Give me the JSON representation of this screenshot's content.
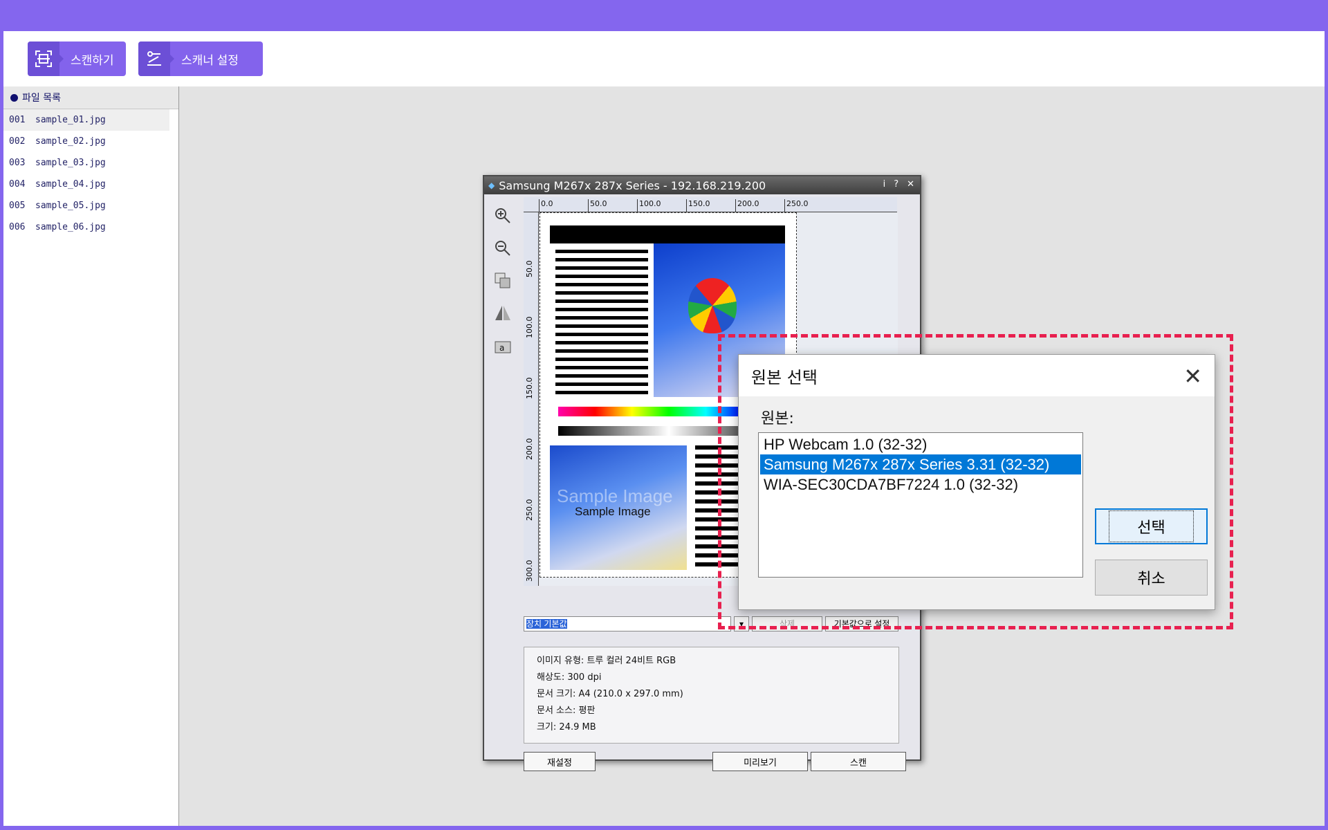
{
  "toolbar": {
    "scan_label": "스캔하기",
    "settings_label": "스캐너 설정"
  },
  "sidebar": {
    "title": "파일 목록",
    "files": [
      {
        "num": "001",
        "name": "sample_01.jpg"
      },
      {
        "num": "002",
        "name": "sample_02.jpg"
      },
      {
        "num": "003",
        "name": "sample_03.jpg"
      },
      {
        "num": "004",
        "name": "sample_04.jpg"
      },
      {
        "num": "005",
        "name": "sample_05.jpg"
      },
      {
        "num": "006",
        "name": "sample_06.jpg"
      }
    ]
  },
  "scanner": {
    "title": "Samsung M267x 287x Series - 192.168.219.200",
    "title_buttons": {
      "info": "i",
      "help": "?",
      "close": "✕"
    },
    "ruler_h": [
      "0.0",
      "50.0",
      "100.0",
      "150.0",
      "200.0",
      "250.0"
    ],
    "ruler_v": [
      "50.0",
      "100.0",
      "150.0",
      "200.0",
      "250.0",
      "300.0"
    ],
    "preview_text": "Sample Image",
    "preset_value": "장치 기본값",
    "delete_label": "삭제",
    "set_default_label": "기본값으로 설정",
    "info": {
      "type": "이미지 유형: 트루 컬러 24비트 RGB",
      "resolution": "해상도: 300 dpi",
      "doc_size": "문서 크기: A4 (210.0 x 297.0 mm)",
      "doc_source": "문서 소스: 평판",
      "size": "크기: 24.9 MB"
    },
    "reset_label": "재설정",
    "preview_label": "미리보기",
    "scan_label": "스캔"
  },
  "dialog": {
    "title": "원본 선택",
    "label": "원본:",
    "sources": [
      "HP Webcam 1.0 (32-32)",
      "Samsung M267x 287x Series 3.31 (32-32)",
      "WIA-SEC30CDA7BF7224 1.0 (32-32)"
    ],
    "selected_index": 1,
    "select_label": "선택",
    "cancel_label": "취소"
  },
  "colors": {
    "brand": "#8466ee",
    "highlight": "#e8204f",
    "selection": "#0078d7"
  }
}
